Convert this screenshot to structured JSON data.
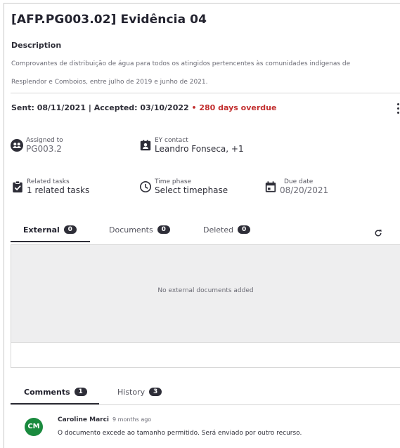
{
  "task": {
    "title": "[AFP.PG003.02] Evidência 04",
    "description_label": "Description",
    "description_line1": "Comprovantes de distribuição de água para todos os atingidos pertencentes às comunidades indígenas de",
    "description_line2": "Resplendor e Comboios, entre julho de 2019 e junho de 2021."
  },
  "status": {
    "sent": "Sent: 08/11/2021",
    "separator": "|",
    "accepted": "Accepted: 03/10/2022",
    "overdue": "• 280 days overdue"
  },
  "fields": {
    "assigned_label": "Assigned to",
    "assigned_value": "PG003.2",
    "ey_label": "EY contact",
    "ey_value": "Leandro Fonseca, +1",
    "related_label": "Related tasks",
    "related_value": "1 related tasks",
    "time_label": "Time phase",
    "time_value": "Select timephase",
    "due_label": "Due date",
    "due_value": "08/20/2021"
  },
  "doc_tabs": [
    {
      "label": "External",
      "count": "0"
    },
    {
      "label": "Documents",
      "count": "0"
    },
    {
      "label": "Deleted",
      "count": "0"
    }
  ],
  "docs_empty": "No external documents added",
  "comment_tabs": [
    {
      "label": "Comments",
      "count": "1"
    },
    {
      "label": "History",
      "count": "3"
    }
  ],
  "comment": {
    "initials": "CM",
    "author": "Caroline Marci",
    "time": "9 months ago",
    "text": "O documento excede ao tamanho permitido. Será enviado por outro recurso."
  },
  "colors": {
    "overdue": "#c22f2f",
    "avatar": "#1a8a3e",
    "badge": "#2e2e38"
  },
  "icons": [
    "group-icon",
    "contact-card-icon",
    "checklist-icon",
    "clock-icon",
    "calendar-icon",
    "refresh-icon",
    "more-vertical-icon"
  ]
}
